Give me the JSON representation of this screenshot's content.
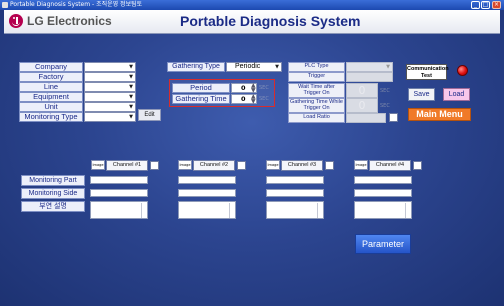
{
  "window": {
    "title": "Portable Diagnosis System - 조직운영 정보팀토"
  },
  "header": {
    "brand": "LG Electronics",
    "app_title": "Portable Diagnosis System"
  },
  "left_panel": {
    "fields": [
      {
        "label": "Company",
        "value": ""
      },
      {
        "label": "Factory",
        "value": ""
      },
      {
        "label": "Line",
        "value": ""
      },
      {
        "label": "Equipment",
        "value": ""
      },
      {
        "label": "Unit",
        "value": ""
      },
      {
        "label": "Monitoring Type",
        "value": ""
      }
    ],
    "edit_label": "Edit"
  },
  "gathering": {
    "type_label": "Gathering Type",
    "type_value": "Periodic",
    "period_label": "Period",
    "period_value": "0",
    "period_unit": "SEC",
    "time_label": "Gathering Time",
    "time_value": "0",
    "time_unit": "SEC"
  },
  "plc": {
    "type_label": "PLC Type",
    "trigger_label": "Trigger",
    "wait_label": "Wait Time after Trigger On",
    "wait_value": "0",
    "wait_unit": "SEC",
    "gather_label": "Gathering Time While Trigger On",
    "gather_value": "0",
    "gather_unit": "SEC",
    "load_ratio_label": "Load Ratio"
  },
  "actions": {
    "comm_test_label": "Communication Test",
    "save_label": "Save",
    "load_label": "Load",
    "main_menu_label": "Main Menu",
    "parameter_label": "Parameter"
  },
  "monitor_labels": {
    "part": "Monitoring Part",
    "side": "Monitoring Side",
    "desc": "부연 설명"
  },
  "channels": [
    {
      "label": "Channel #1",
      "image": "Image"
    },
    {
      "label": "Channel #2",
      "image": "Image"
    },
    {
      "label": "Channel #3",
      "image": "Image"
    },
    {
      "label": "Channel #4",
      "image": "Image"
    }
  ],
  "colors": {
    "brand": "#b5004f",
    "title": "#1b2b86",
    "indicator": "#e01010",
    "main_menu": "#f07a28",
    "parameter": "#2f67e0"
  }
}
